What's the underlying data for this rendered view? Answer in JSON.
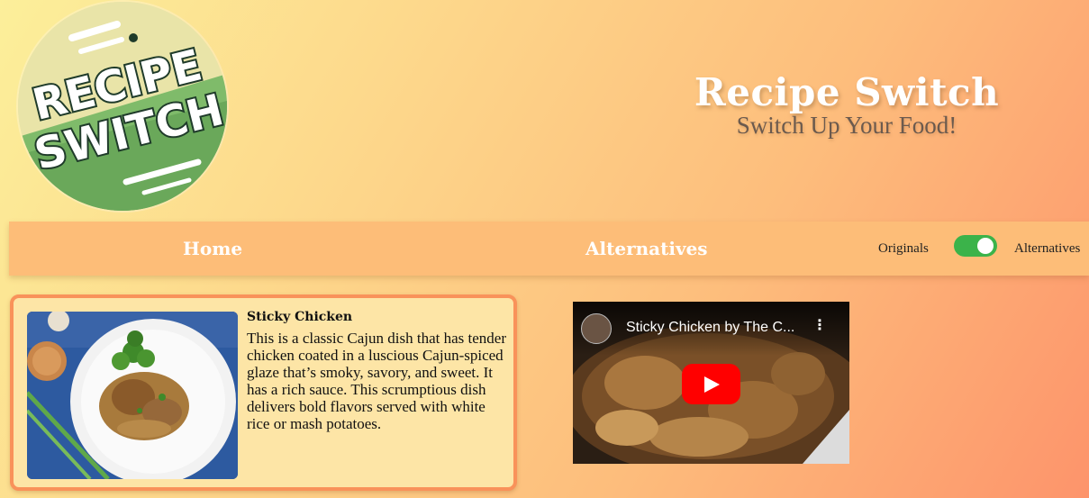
{
  "logo": {
    "line1": "RECIPE",
    "line2": "SWITCH"
  },
  "brand": {
    "title": "Recipe Switch",
    "subtitle": "Switch Up Your Food!"
  },
  "nav": {
    "home": "Home",
    "alternatives": "Alternatives"
  },
  "toggle": {
    "left_label": "Originals",
    "right_label": "Alternatives",
    "state": "on",
    "color": "#3bb34a"
  },
  "recipe": {
    "title": "Sticky Chicken",
    "description": "This is a classic Cajun dish that has tender chicken coated in a luscious Cajun-spiced glaze that’s smoky, savory, and sweet. It has a rich sauce. This scrumptious dish delivers bold flavors served with white rice or mash potatoes."
  },
  "video": {
    "title": "Sticky Chicken by The C...",
    "menu_icon": "more-vert-icon",
    "play_icon": "youtube-play-icon"
  },
  "colors": {
    "accent": "#f9925a",
    "navbar": "#fdbd78",
    "card_bg": "#fde5a6"
  }
}
